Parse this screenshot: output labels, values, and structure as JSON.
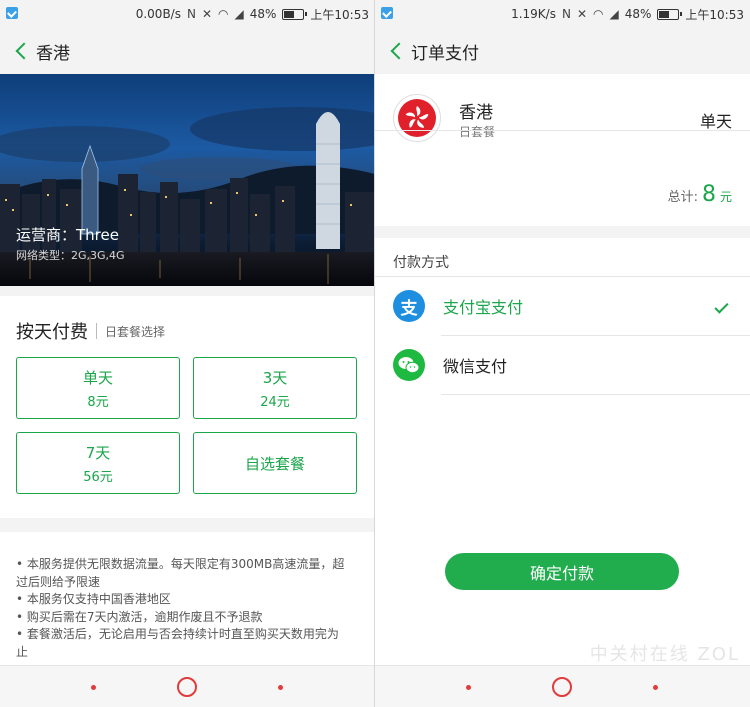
{
  "left": {
    "status": {
      "speed": "0.00B/s",
      "battery": "48%",
      "time": "上午10:53"
    },
    "header": {
      "title": "香港"
    },
    "hero": {
      "operator": "运营商：Three",
      "network": "网络类型：2G,3G,4G"
    },
    "plans": {
      "title": "按天付费",
      "subtitle": "日套餐选择",
      "items": [
        {
          "name": "单天",
          "price": "8元"
        },
        {
          "name": "3天",
          "price": "24元"
        },
        {
          "name": "7天",
          "price": "56元"
        },
        {
          "name": "自选套餐",
          "price": ""
        }
      ]
    },
    "notes": [
      "• 本服务提供无限数据流量。每天限定有300MB高速流量，超",
      "过后则给予限速",
      "• 本服务仅支持中国香港地区",
      "• 购买后需在7天内激活，逾期作废且不予退款",
      "• 套餐激活后，无论启用与否会持续计时直至购买天数用完为",
      "止"
    ]
  },
  "right": {
    "status": {
      "speed": "1.19K/s",
      "battery": "48%",
      "time": "上午10:53"
    },
    "header": {
      "title": "订单支付"
    },
    "order": {
      "name": "香港",
      "type": "日套餐",
      "duration": "单天",
      "total_label": "总计:",
      "total_value": "8",
      "total_unit": "元"
    },
    "payment": {
      "title": "付款方式",
      "methods": [
        {
          "label": "支付宝支付",
          "icon": "alipay-icon",
          "selected": true
        },
        {
          "label": "微信支付",
          "icon": "wechat-pay-icon",
          "selected": false
        }
      ],
      "confirm": "确定付款"
    }
  },
  "colors": {
    "accent": "#1aa64a",
    "alipay": "#1e8fe0",
    "wechat": "#1db940",
    "nav": "#e23b3b"
  },
  "watermark": "中关村在线 ZOL"
}
